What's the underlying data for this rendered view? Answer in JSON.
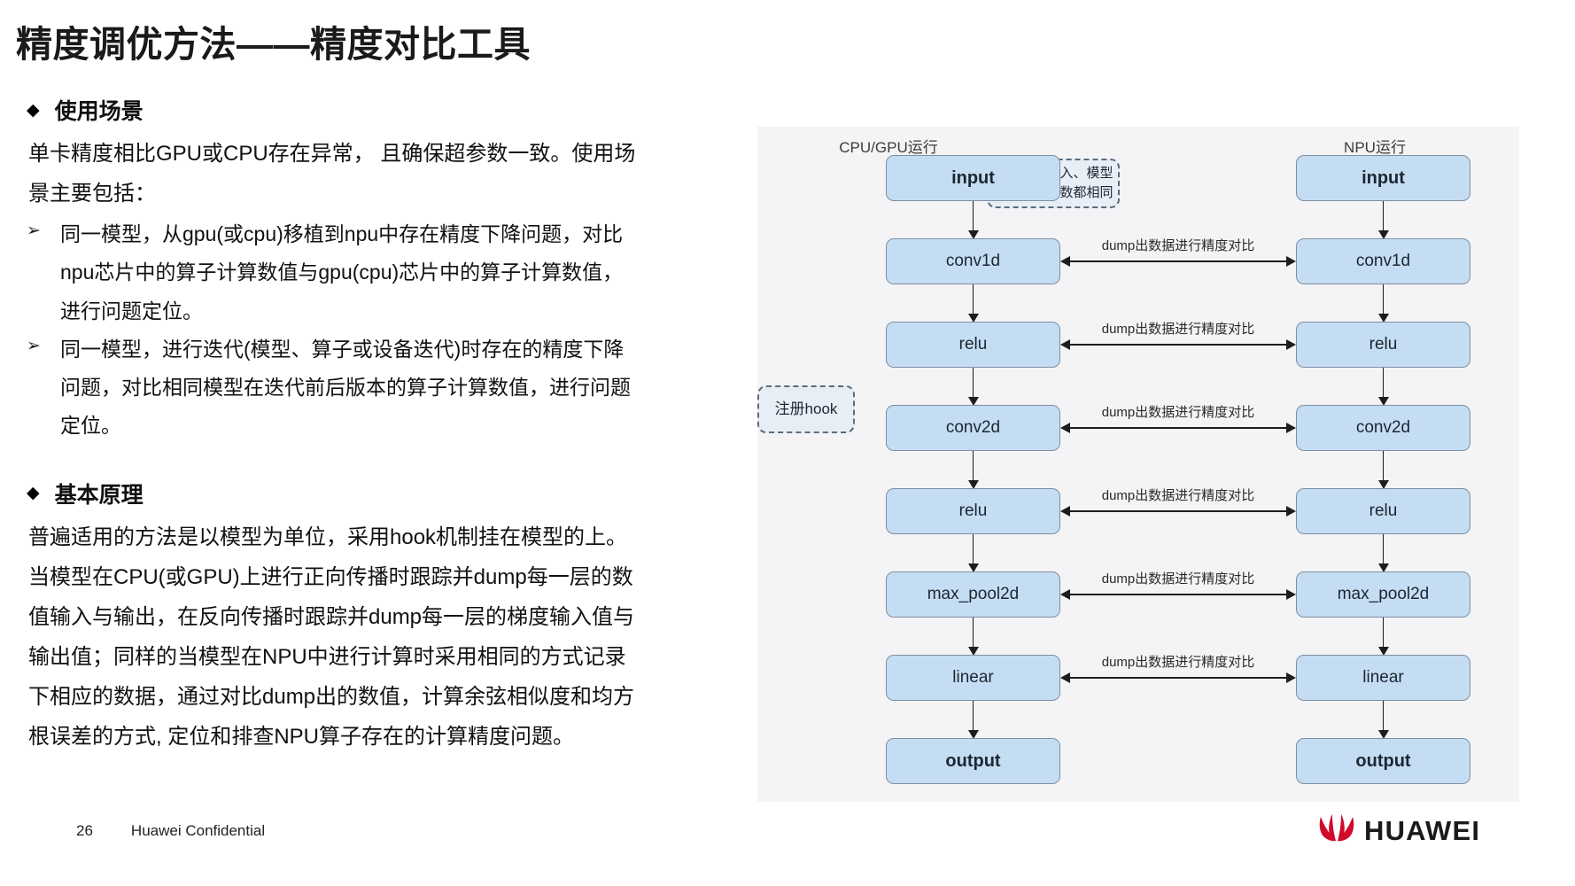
{
  "slide": {
    "title": "精度调优方法——精度对比工具",
    "page_number": "26",
    "confidential": "Huawei Confidential",
    "brand": "HUAWEI",
    "brand_color": "#cf0a2c"
  },
  "sections": [
    {
      "bullet_glyph": "◆",
      "heading": "使用场景",
      "intro": "单卡精度相比GPU或CPU存在异常， 且确保超参数一致。使用场景主要包括：",
      "items": [
        {
          "marker": "➢",
          "text": "同一模型，从gpu(或cpu)移植到npu中存在精度下降问题，对比npu芯片中的算子计算数值与gpu(cpu)芯片中的算子计算数值，进行问题定位。"
        },
        {
          "marker": "➢",
          "text": "同一模型，进行迭代(模型、算子或设备迭代)时存在的精度下降问题，对比相同模型在迭代前后版本的算子计算数值，进行问题定位。"
        }
      ]
    },
    {
      "bullet_glyph": "◆",
      "heading": "基本原理",
      "intro": "普遍适用的方法是以模型为单位，采用hook机制挂在模型的上。当模型在CPU(或GPU)上进行正向传播时跟踪并dump每一层的数值输入与输出，在反向传播时跟踪并dump每一层的梯度输入值与输出值；同样的当模型在NPU中进行计算时采用相同的方式记录下相应的数据，通过对比dump出的数值，计算余弦相似度和均方根误差的方式, 定位和排查NPU算子存在的计算精度问题。",
      "items": []
    }
  ],
  "diagram": {
    "background": "#f4f4f6",
    "node_fill": "#c5ddf2",
    "node_border": "#7d8fa3",
    "left_column_title": "CPU/GPU运行",
    "right_column_title": "NPU运行",
    "control_note": {
      "line1": "控制模型输入、模型",
      "line2": "参数和超参数都相同"
    },
    "hook_note": "注册hook",
    "dump_label": "dump出数据进行精度对比",
    "left_nodes": [
      {
        "label": "input",
        "emphasis": true
      },
      {
        "label": "conv1d",
        "emphasis": false
      },
      {
        "label": "relu",
        "emphasis": false
      },
      {
        "label": "conv2d",
        "emphasis": false
      },
      {
        "label": "relu",
        "emphasis": false
      },
      {
        "label": "max_pool2d",
        "emphasis": false
      },
      {
        "label": "linear",
        "emphasis": false
      },
      {
        "label": "output",
        "emphasis": true
      }
    ],
    "right_nodes": [
      {
        "label": "input",
        "emphasis": true
      },
      {
        "label": "conv1d",
        "emphasis": false
      },
      {
        "label": "relu",
        "emphasis": false
      },
      {
        "label": "conv2d",
        "emphasis": false
      },
      {
        "label": "relu",
        "emphasis": false
      },
      {
        "label": "max_pool2d",
        "emphasis": false
      },
      {
        "label": "linear",
        "emphasis": false
      },
      {
        "label": "output",
        "emphasis": true
      }
    ],
    "compare_rows": [
      1,
      2,
      3,
      4,
      5,
      6
    ]
  }
}
